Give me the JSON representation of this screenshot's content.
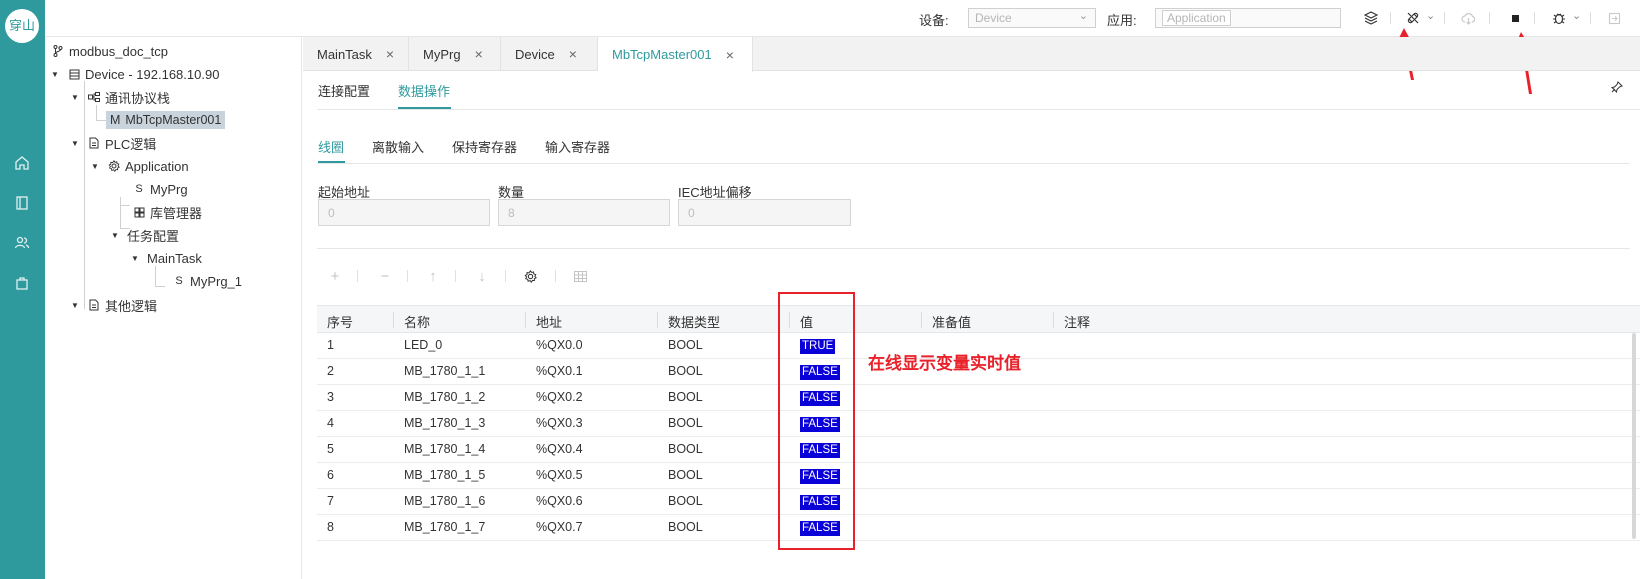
{
  "app": {
    "logo_text": "穿山",
    "rail_icons": [
      "home-icon",
      "book-icon",
      "users-icon",
      "bag-icon"
    ]
  },
  "topbar": {
    "device_label": "设备:",
    "device_value": "Device",
    "app_label": "应用:",
    "app_value": "Application",
    "icons": [
      "layers-icon",
      "disconnect-icon",
      "download-cloud-icon",
      "stop-icon",
      "debug-bug-icon",
      "logout-icon"
    ]
  },
  "tree": {
    "project": "modbus_doc_tcp",
    "device": "Device - 192.168.10.90",
    "comm_stack": "通讯协议栈",
    "master_prefix": "M",
    "master": "MbTcpMaster001",
    "plc_logic": "PLC逻辑",
    "application": "Application",
    "prg_prefix": "S",
    "myprg": "MyPrg",
    "library": "库管理器",
    "task_config": "任务配置",
    "maintask": "MainTask",
    "myprg1_prefix": "S",
    "myprg1": "MyPrg_1",
    "other_logic": "其他逻辑"
  },
  "tabs": [
    {
      "label": "MainTask",
      "close": "×"
    },
    {
      "label": "MyPrg",
      "close": "×"
    },
    {
      "label": "Device",
      "close": "×"
    },
    {
      "label": "MbTcpMaster001",
      "close": "×"
    }
  ],
  "subtabs": {
    "conn_config": "连接配置",
    "data_ops": "数据操作"
  },
  "register_tabs": {
    "coils": "线圈",
    "discrete": "离散输入",
    "holding": "保持寄存器",
    "input": "输入寄存器"
  },
  "fields": {
    "start_label": "起始地址",
    "start_value": "0",
    "count_label": "数量",
    "count_value": "8",
    "iec_label": "IEC地址偏移",
    "iec_value": "0"
  },
  "toolbar": {
    "add": "+",
    "remove": "−",
    "up": "↑",
    "down": "↓"
  },
  "table": {
    "headers": {
      "index": "序号",
      "name": "名称",
      "address": "地址",
      "type": "数据类型",
      "value": "值",
      "prepared": "准备值",
      "comment": "注释"
    },
    "rows": [
      {
        "index": "1",
        "name": "LED_0",
        "address": "%QX0.0",
        "type": "BOOL",
        "value": "TRUE"
      },
      {
        "index": "2",
        "name": "MB_1780_1_1",
        "address": "%QX0.1",
        "type": "BOOL",
        "value": "FALSE"
      },
      {
        "index": "3",
        "name": "MB_1780_1_2",
        "address": "%QX0.2",
        "type": "BOOL",
        "value": "FALSE"
      },
      {
        "index": "4",
        "name": "MB_1780_1_3",
        "address": "%QX0.3",
        "type": "BOOL",
        "value": "FALSE"
      },
      {
        "index": "5",
        "name": "MB_1780_1_4",
        "address": "%QX0.4",
        "type": "BOOL",
        "value": "FALSE"
      },
      {
        "index": "6",
        "name": "MB_1780_1_5",
        "address": "%QX0.5",
        "type": "BOOL",
        "value": "FALSE"
      },
      {
        "index": "7",
        "name": "MB_1780_1_6",
        "address": "%QX0.6",
        "type": "BOOL",
        "value": "FALSE"
      },
      {
        "index": "8",
        "name": "MB_1780_1_7",
        "address": "%QX0.7",
        "type": "BOOL",
        "value": "FALSE"
      }
    ]
  },
  "annotation": {
    "text": "在线显示变量实时值",
    "color": "#e8212a"
  },
  "colors": {
    "accent": "#2f9a9e",
    "value_badge": "#0a00d8"
  }
}
